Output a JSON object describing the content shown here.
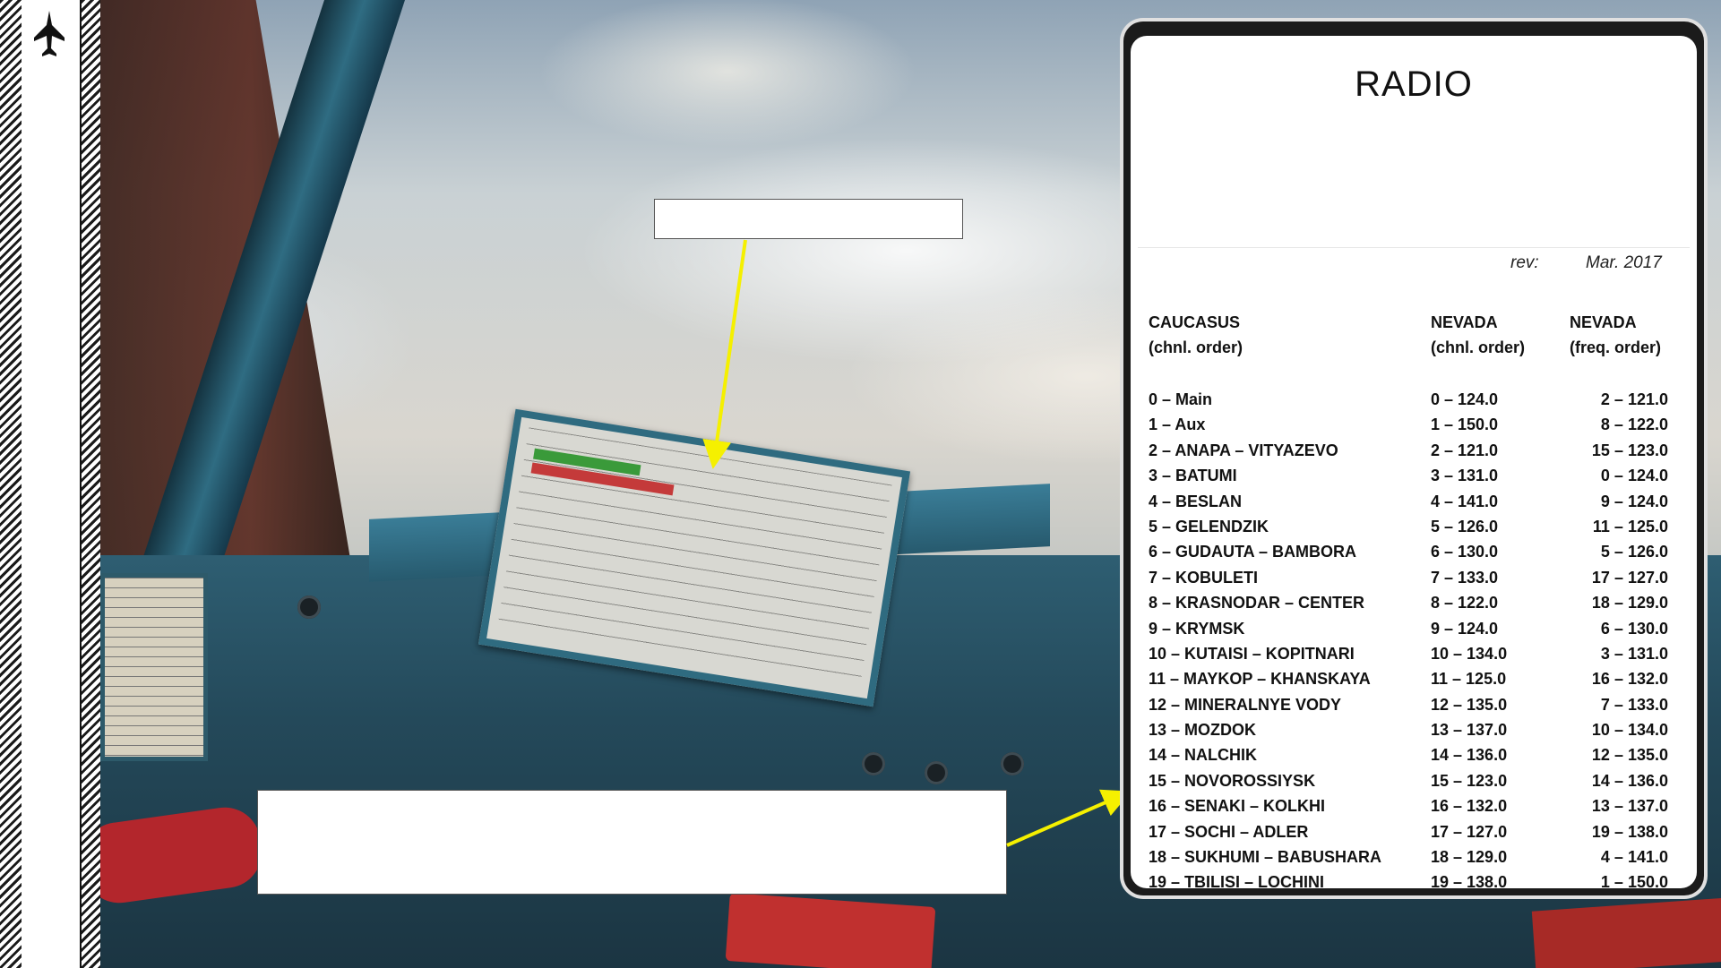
{
  "radio_card": {
    "title": "RADIO",
    "rev_label": "rev:",
    "rev_date": "Mar. 2017",
    "columns": [
      {
        "heading": "CAUCASUS",
        "subheading": "(chnl. order)"
      },
      {
        "heading": "NEVADA",
        "subheading": "(chnl. order)"
      },
      {
        "heading": "NEVADA",
        "subheading": "(freq. order)"
      }
    ],
    "caucasus_chnl": [
      "0 – Main",
      "1 – Aux",
      "2 – ANAPA – VITYAZEVO",
      "3 – BATUMI",
      "4 – BESLAN",
      "5 – GELENDZIK",
      "6 – GUDAUTA – BAMBORA",
      "7 – KOBULETI",
      "8 – KRASNODAR – CENTER",
      "9 – KRYMSK",
      "10 – KUTAISI – KOPITNARI",
      "11 – MAYKOP – KHANSKAYA",
      "12 – MINERALNYE VODY",
      "13 – MOZDOK",
      "14 – NALCHIK",
      "15 – NOVOROSSIYSK",
      "16 – SENAKI – KOLKHI",
      "17 – SOCHI – ADLER",
      "18 – SUKHUMI – BABUSHARA",
      "19 – TBILISI – LOCHINI"
    ],
    "nevada_chnl": [
      "0 – 124.0",
      "1 – 150.0",
      "2 – 121.0",
      "3 – 131.0",
      "4 – 141.0",
      "5 – 126.0",
      "6 – 130.0",
      "7 – 133.0",
      "8 – 122.0",
      "9 – 124.0",
      "10 – 134.0",
      "11 – 125.0",
      "12 – 135.0",
      "13 – 137.0",
      "14 – 136.0",
      "15 – 123.0",
      "16 – 132.0",
      "17 – 127.0",
      "18 – 129.0",
      "19 – 138.0"
    ],
    "nevada_freq": [
      "2 – 121.0",
      "8 – 122.0",
      "15 – 123.0",
      "0 – 124.0",
      "9 – 124.0",
      "11 – 125.0",
      "5 – 126.0",
      "17 – 127.0",
      "18 – 129.0",
      "6 – 130.0",
      "3 – 131.0",
      "16 – 132.0",
      "7 – 133.0",
      "10 – 134.0",
      "12 – 135.0",
      "14 – 136.0",
      "13 – 137.0",
      "19 – 138.0",
      "4 – 141.0",
      "1 – 150.0"
    ]
  },
  "colors": {
    "arrow": "#f5f000",
    "card_border": "#1b1b1b",
    "sidebar": "#ffffff"
  },
  "icons": {
    "sidebar": "fighter-jet-icon"
  }
}
